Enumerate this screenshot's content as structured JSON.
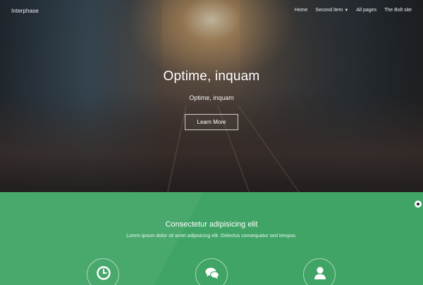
{
  "brand": "Interphase",
  "nav": {
    "items": [
      {
        "label": "Home"
      },
      {
        "label": "Second item",
        "caret": "▼"
      },
      {
        "label": "All pages"
      },
      {
        "label": "The Bolt site"
      }
    ]
  },
  "hero": {
    "title": "Optime, inquam",
    "subtitle": "Optime, inquam",
    "button_label": "Learn More"
  },
  "features": {
    "title": "Consectetur adipisicing elit",
    "text": "Lorem ipsum dolor sit amet adipisicing elit. Delectus consequatur sed tempus.",
    "icons": [
      "clock-icon",
      "chat-icon",
      "user-icon"
    ]
  },
  "colors": {
    "accent_green": "#3fa465",
    "text_light": "#ffffff"
  }
}
